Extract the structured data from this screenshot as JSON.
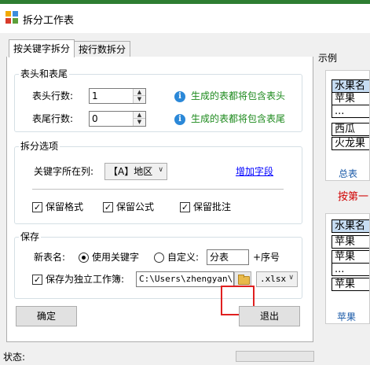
{
  "window": {
    "title": "拆分工作表"
  },
  "tabs": [
    {
      "label": "按关键字拆分",
      "active": true
    },
    {
      "label": "按行数拆分",
      "active": false
    }
  ],
  "header_footer_group": {
    "title": "表头和表尾",
    "header_rows_label": "表头行数:",
    "header_rows_value": "1",
    "header_hint": "生成的表都将包含表头",
    "footer_rows_label": "表尾行数:",
    "footer_rows_value": "0",
    "footer_hint": "生成的表都将包含表尾"
  },
  "split_options_group": {
    "title": "拆分选项",
    "key_column_label": "关键字所在列:",
    "key_column_value": "【A】地区",
    "add_field_link": "增加字段",
    "keep_format": {
      "label": "保留格式",
      "checked": true
    },
    "keep_formula": {
      "label": "保留公式",
      "checked": true
    },
    "keep_comment": {
      "label": "保留批注",
      "checked": true
    }
  },
  "save_group": {
    "title": "保存",
    "new_name_label": "新表名:",
    "use_keyword_option": {
      "label": "使用关键字",
      "selected": true
    },
    "custom_option": {
      "label": "自定义:",
      "selected": false
    },
    "custom_name_value": "分表",
    "suffix_text": "+序号",
    "save_as_workbook": {
      "label": "保存为独立工作簿:",
      "checked": true
    },
    "path_value": "C:\\Users\\zhengyan\\De",
    "extension_value": ".xlsx"
  },
  "buttons": {
    "ok": "确定",
    "exit": "退出"
  },
  "example": {
    "title": "示例",
    "top_sheet": {
      "rows": [
        "水果名",
        "苹果",
        "...",
        "西瓜",
        "火龙果"
      ],
      "tab": "总表"
    },
    "middle_text": "按第一",
    "bottom_sheet": {
      "rows": [
        "水果名",
        "苹果",
        "苹果",
        "...",
        "苹果"
      ],
      "tab": "苹果"
    }
  },
  "statusbar": {
    "label": "状态:"
  },
  "colors": {
    "title_strip": "#2e7d32",
    "hint_green": "#1d8a1d",
    "link_blue": "#0000ff",
    "highlight_red": "#e02020",
    "example_red": "#d00000",
    "header_cell": "#c6dcf2"
  }
}
